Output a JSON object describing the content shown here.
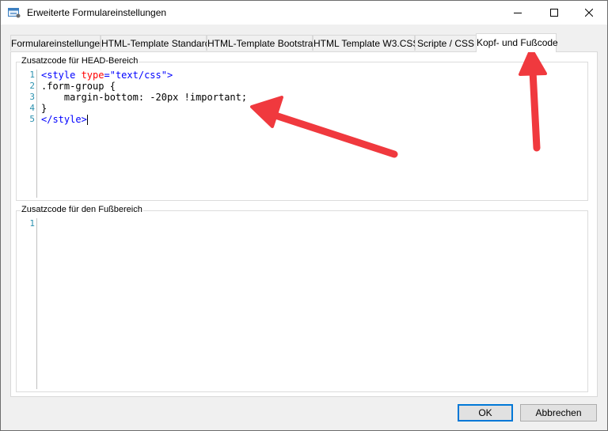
{
  "window": {
    "title": "Erweiterte Formulareinstellungen",
    "controls": {
      "minimize": "minimize",
      "maximize": "maximize",
      "close": "close"
    }
  },
  "tabs": [
    {
      "label": "Formulareinstellungen",
      "active": false
    },
    {
      "label": "HTML-Template Standard",
      "active": false
    },
    {
      "label": "HTML-Template Bootstrap",
      "active": false
    },
    {
      "label": "HTML Template W3.CSS",
      "active": false
    },
    {
      "label": "Scripte / CSS",
      "active": false
    },
    {
      "label": "Kopf- und Fußcode",
      "active": true
    }
  ],
  "head_section": {
    "label": "Zusatzcode für HEAD-Bereich",
    "line_numbers": [
      "1",
      "2",
      "3",
      "4",
      "5"
    ],
    "code": {
      "line1_open": "<style ",
      "line1_attr": "type",
      "line1_eq": "=",
      "line1_val": "\"text/css\"",
      "line1_close": ">",
      "line2": ".form-group {",
      "line3": "    margin-bottom: -20px !important;",
      "line4": "}",
      "line5": "</style>"
    }
  },
  "foot_section": {
    "label": "Zusatzcode für den Fußbereich",
    "line_numbers": [
      "1"
    ]
  },
  "buttons": {
    "ok": "OK",
    "cancel": "Abbrechen"
  },
  "colors": {
    "annotation_arrow": "#f0393e",
    "tag": "#0000ff",
    "attribute": "#ff0000",
    "line_number": "#2b91af",
    "default_button_border": "#0078d7"
  }
}
